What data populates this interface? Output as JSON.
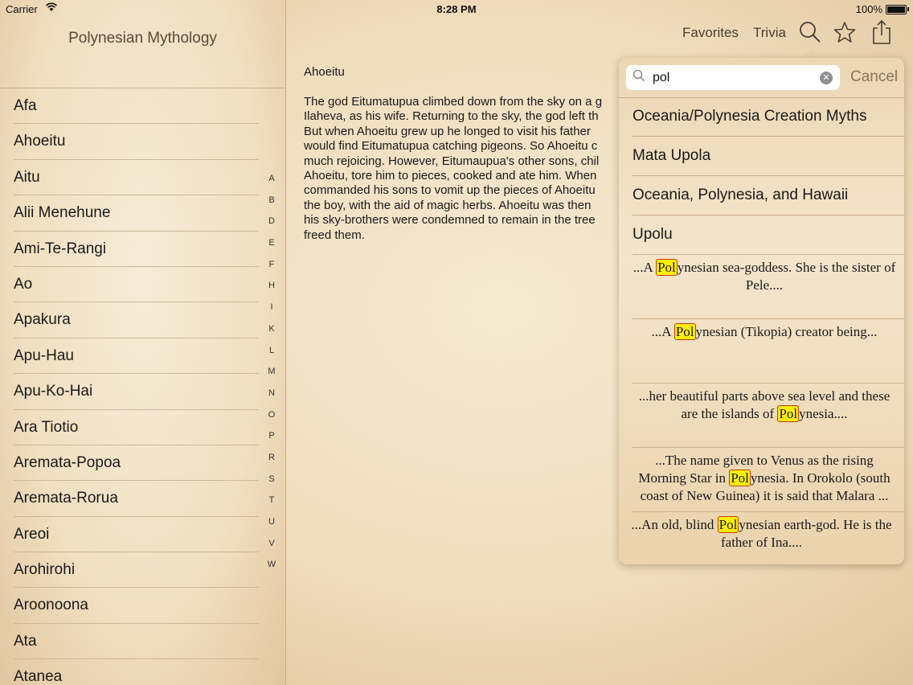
{
  "status_bar": {
    "carrier": "Carrier",
    "time": "8:28 PM",
    "battery": "100%"
  },
  "sidebar": {
    "title": "Polynesian Mythology",
    "items": [
      "Afa",
      "Ahoeitu",
      "Aitu",
      "Alii Menehune",
      "Ami-Te-Rangi",
      "Ao",
      "Apakura",
      "Apu-Hau",
      "Apu-Ko-Hai",
      "Ara Tiotio",
      "Aremata-Popoa",
      "Aremata-Rorua",
      "Areoi",
      "Arohirohi",
      "Aroonoona",
      "Ata",
      "Atanea"
    ],
    "index": [
      "A",
      "B",
      "D",
      "E",
      "F",
      "H",
      "I",
      "K",
      "L",
      "M",
      "N",
      "O",
      "P",
      "R",
      "S",
      "T",
      "U",
      "V",
      "W"
    ]
  },
  "toolbar": {
    "favorites": "Favorites",
    "trivia": "Trivia",
    "icons": [
      "search-icon",
      "star-icon",
      "share-icon"
    ]
  },
  "article": {
    "title": "Ahoeitu",
    "lines": [
      "The god Eitumatupua climbed down from the sky on a g",
      "Ilaheva, as his wife. Returning to the sky, the god left th",
      "But when Ahoeitu grew up he longed to visit his father",
      "would find Eitumatupua catching pigeons. So Ahoeitu c",
      "much rejoicing. However, Eitumaupua's other sons, chil",
      "Ahoeitu, tore him to pieces, cooked and ate him. When",
      "commanded his sons to vomit up the pieces of Ahoeitu",
      "the boy, with the aid of magic herbs. Ahoeitu was then",
      "his sky-brothers were condemned to remain in the tree",
      "freed them."
    ]
  },
  "search": {
    "query": "pol",
    "cancel": "Cancel",
    "results": [
      "Oceania/Polynesia Creation Myths",
      "Mata Upola",
      "Oceania, Polynesia, and Hawaii",
      "Upolu"
    ],
    "snippets": [
      {
        "before": "...A ",
        "match": "Pol",
        "after": "ynesian sea-goddess. She is the sister of Pele...."
      },
      {
        "before": "...A ",
        "match": "Pol",
        "after": "ynesian (Tikopia) creator being..."
      },
      {
        "before": "...her beautiful parts above sea level and these are the islands of ",
        "match": "Pol",
        "after": "ynesia...."
      },
      {
        "before": "...The name given to Venus as the rising Morning Star in ",
        "match": "Pol",
        "after": "ynesia. In Orokolo (south coast of New Guinea) it is said that Malara ..."
      },
      {
        "before": "...An old, blind ",
        "match": "Pol",
        "after": "ynesian earth-god. He is the father of Ina...."
      }
    ]
  }
}
